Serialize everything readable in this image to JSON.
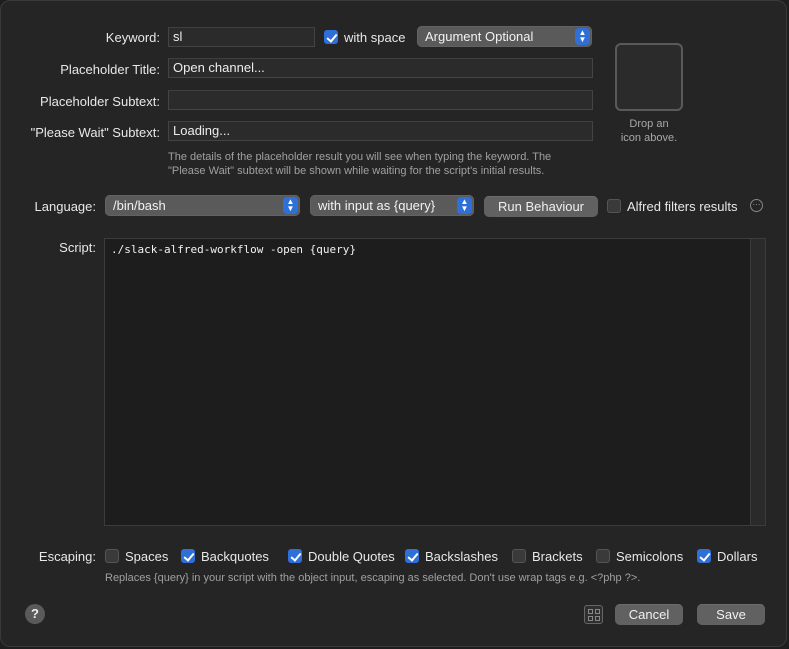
{
  "keyword": {
    "label": "Keyword:",
    "value": "sl",
    "with_space_label": "with space",
    "with_space_checked": true,
    "argument_popup": "Argument Optional"
  },
  "placeholder_title": {
    "label": "Placeholder Title:",
    "value": "Open channel..."
  },
  "placeholder_subtext": {
    "label": "Placeholder Subtext:",
    "value": ""
  },
  "please_wait_subtext": {
    "label": "\"Please Wait\" Subtext:",
    "value": "Loading..."
  },
  "placeholder_hint": {
    "line1": "The details of the placeholder result you will see when typing the keyword. The",
    "line2": "\"Please Wait\" subtext will be shown while waiting for the script's initial results."
  },
  "icon_drop": {
    "line1": "Drop an",
    "line2": "icon above."
  },
  "language": {
    "label": "Language:",
    "value": "/bin/bash",
    "input_mode": "with input as {query}",
    "run_behaviour_label": "Run Behaviour",
    "alfred_filters_label": "Alfred filters results",
    "alfred_filters_checked": false,
    "more_icon": "ellipsis-circle-icon"
  },
  "script": {
    "label": "Script:",
    "content": "./slack-alfred-workflow -open {query}"
  },
  "escaping": {
    "label": "Escaping:",
    "options": [
      {
        "label": "Spaces",
        "checked": false
      },
      {
        "label": "Backquotes",
        "checked": true
      },
      {
        "label": "Double Quotes",
        "checked": true
      },
      {
        "label": "Backslashes",
        "checked": true
      },
      {
        "label": "Brackets",
        "checked": false
      },
      {
        "label": "Semicolons",
        "checked": false
      },
      {
        "label": "Dollars",
        "checked": true
      }
    ],
    "hint": "Replaces {query} in your script with the object input, escaping as selected. Don't use wrap tags e.g. <?php ?>."
  },
  "footer": {
    "help_label": "?",
    "cancel_label": "Cancel",
    "save_label": "Save",
    "grid_icon": "grid-icon"
  },
  "colors": {
    "accent": "#2f6fd8",
    "background": "#252525"
  }
}
